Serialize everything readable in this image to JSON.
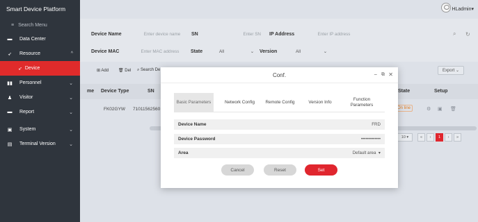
{
  "sidebar": {
    "brand": "Smart Device Platform",
    "search_label": "Search Menu",
    "items": [
      {
        "label": "Data Center",
        "icon": "monitor-icon"
      },
      {
        "label": "Resource",
        "icon": "rocket-icon",
        "chevron": "^"
      },
      {
        "label": "Device",
        "icon": "rocket-icon"
      },
      {
        "label": "Personnel",
        "icon": "people-icon",
        "chevron": "v"
      },
      {
        "label": "Visitor",
        "icon": "person-icon",
        "chevron": "v"
      },
      {
        "label": "Report",
        "icon": "monitor-icon",
        "chevron": "v"
      },
      {
        "label": "System",
        "icon": "gear-icon",
        "chevron": "v"
      },
      {
        "label": "Terminal Version",
        "icon": "terminal-icon",
        "chevron": "v"
      }
    ]
  },
  "topbar": {
    "username": "HLadmin"
  },
  "filters": {
    "device_name_label": "Device Name",
    "device_name_placeholder": "Enter device name",
    "sn_label": "SN",
    "sn_placeholder": "Enter SN",
    "ip_label": "IP Address",
    "ip_placeholder": "Enter IP address",
    "mac_label": "Device MAC",
    "mac_placeholder": "Enter MAC address",
    "state_label": "State",
    "state_value": "All",
    "version_label": "Version",
    "version_value": "All"
  },
  "toolbar": {
    "add_label": "Add",
    "del_label": "Del",
    "search_label": "Search De",
    "export_label": "Export"
  },
  "table": {
    "col_name_partial": "me",
    "col_device_type": "Device Type",
    "col_sn": "SN",
    "col_state": "State",
    "col_setup": "Setup",
    "row": {
      "device_type": "FK02GYW",
      "sn": "71011562560",
      "state": "On line"
    }
  },
  "pagination": {
    "page_size": "10",
    "current_page": "1"
  },
  "modal": {
    "title": "Conf.",
    "tabs": [
      {
        "label": "Basic Parameters",
        "active": true
      },
      {
        "label": "Network Config"
      },
      {
        "label": "Remote Config"
      },
      {
        "label": "Version Info"
      },
      {
        "label": "Function Parameters"
      }
    ],
    "fields": [
      {
        "label": "Device Name",
        "value": "FRD"
      },
      {
        "label": "Device Password",
        "value": "•••••••••••••"
      },
      {
        "label": "Area",
        "value": "Default area"
      }
    ],
    "cancel_label": "Cancel",
    "reset_label": "Reset",
    "set_label": "Set"
  },
  "colors": {
    "sidebar_bg": "#2f353d",
    "accent_red": "#e02b2b",
    "modal_bg": "#ffffff"
  }
}
